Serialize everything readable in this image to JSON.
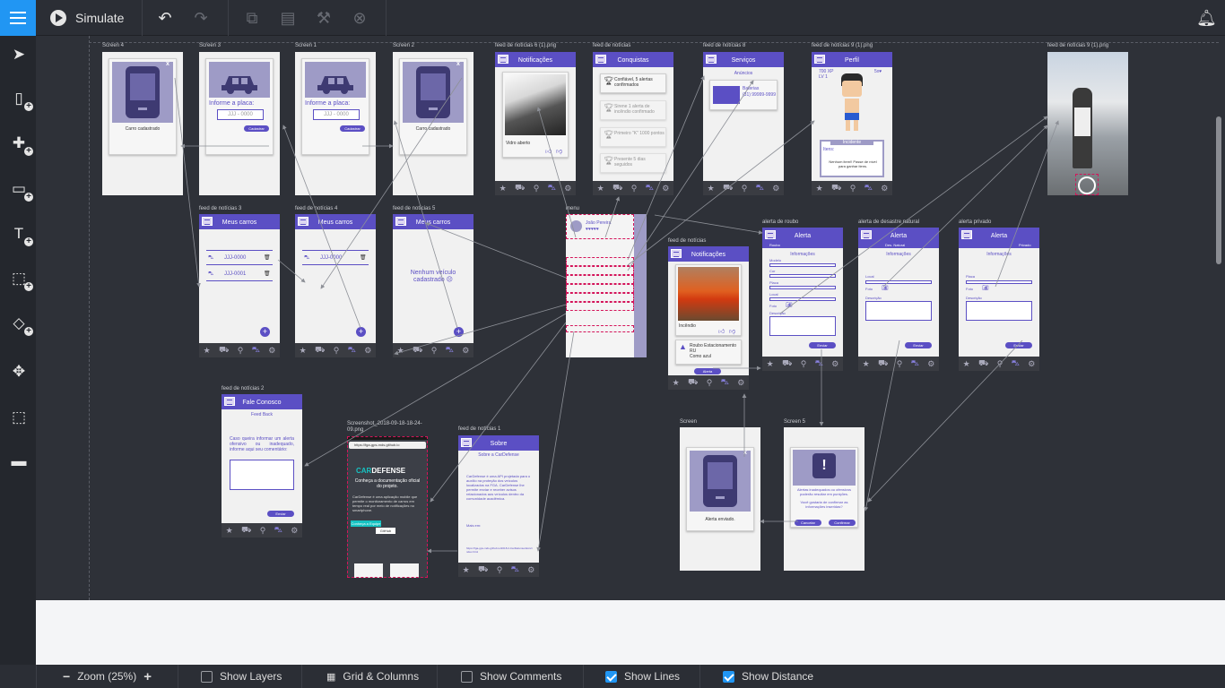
{
  "toolbar": {
    "simulate_label": "Simulate",
    "icons": [
      "menu-icon",
      "play-icon",
      "undo-icon",
      "redo-icon",
      "copy-icon",
      "paste-icon",
      "format-painter-icon",
      "delete-icon",
      "bell-icon"
    ]
  },
  "sidebar": {
    "tools": [
      "pointer-icon",
      "device-add-icon",
      "component-add-icon",
      "rectangle-add-icon",
      "text-add-icon",
      "selection-add-icon",
      "fill-icon",
      "move-icon",
      "area-select-icon",
      "comment-icon"
    ]
  },
  "statusbar": {
    "zoom_label": "Zoom (25%)",
    "show_layers": "Show Layers",
    "grid_columns": "Grid & Columns",
    "show_comments": "Show Comments",
    "show_lines": "Show Lines",
    "show_distance": "Show Distance",
    "show_layers_checked": false,
    "show_comments_checked": false,
    "show_lines_checked": true,
    "show_distance_checked": true
  },
  "accent": "#5b4fc4",
  "screens": {
    "screen4": {
      "label": "Screen 4",
      "caption": "Carro cadastrado"
    },
    "screen3": {
      "label": "Screen 3",
      "prompt": "Informe a placa:",
      "placeholder": "JJJ - 0000",
      "button": "Cadastrar"
    },
    "screen1": {
      "label": "Screen 1",
      "prompt": "Informe a placa:",
      "placeholder": "JJJ - 0000",
      "button": "Cadastrar"
    },
    "screen2": {
      "label": "Screen 2",
      "caption": "Carro cadastrado"
    },
    "feed6": {
      "label": "feed de notícias 6 (1).png",
      "title": "Notificações",
      "caption": "Vidro aberto"
    },
    "conquistas": {
      "label": "feed de notícias",
      "title": "Conquistas",
      "items": [
        "Confiável, 5 alertas confirmados",
        "Sirene 1 alerta de incêndio confirmado",
        "Primeiro \"K\" 1000 pontos",
        "Presente 5 dias seguidos"
      ]
    },
    "servicos": {
      "label": "feed de notícias 8",
      "title": "Serviços",
      "subtitle": "Anúncios",
      "ad_title": "Baterias",
      "ad_phone": "(31) 99999-9999"
    },
    "perfil": {
      "label": "feed de notícias 9 (1).png",
      "title": "Perfil",
      "xp": "700 XP",
      "level": "LV 1",
      "likes": "5x♥",
      "section": "Incidente",
      "items_label": "Itens:",
      "items_text": "Nenhum item!! Passe de nível para ganhar itens."
    },
    "photo9": {
      "label": "feed de notícias 9 (1).png"
    },
    "feed3": {
      "label": "feed de notícias 3",
      "title": "Meus carros",
      "plates": [
        "JJJ-0000",
        "JJJ-0001"
      ]
    },
    "feed4": {
      "label": "feed de notícias 4",
      "title": "Meus carros",
      "plates": [
        "JJJ-0000"
      ]
    },
    "feed5": {
      "label": "feed de notícias 5",
      "title": "Meus carros",
      "empty": "Nenhum veículo cadastrado ☹"
    },
    "menu": {
      "label": "menu",
      "user": "João Pereira",
      "hearts": "♥♥♥♥♥"
    },
    "notif": {
      "label": "feed de notícias",
      "title": "Notificações",
      "caption": "Incêndio",
      "alert_title": "Roubo Estacionamento RU",
      "alert_sub": "Como azul",
      "button": "Alerta"
    },
    "roubo": {
      "label": "alerta de roubo",
      "title": "Alerta",
      "tab": "Roubo",
      "section": "Informações",
      "fields": [
        "Modelo",
        "Cor",
        "Placa",
        "Local",
        "Foto",
        "Descrição"
      ],
      "button": "Enviar"
    },
    "desastre": {
      "label": "alerta de desastre natural",
      "title": "Alerta",
      "tab": "Des. Natural",
      "section": "Informações",
      "fields": [
        "Local",
        "Foto",
        "Descrição"
      ],
      "button": "Enviar"
    },
    "privado": {
      "label": "alerta privado",
      "title": "Alerta",
      "tab": "Privado",
      "section": "Informações",
      "fields": [
        "Placa",
        "Foto",
        "Descrição"
      ],
      "button": "Enviar"
    },
    "fale": {
      "label": "feed de notícias 2",
      "title": "Fale Conosco",
      "subtitle": "Feed Back",
      "body": "Caso queira informar um alerta ofensivo ou inadequado, informe aqui seu comentário:",
      "button": "Enviar"
    },
    "screenshot": {
      "label": "Screenshot_2018-09-18-18-24-09.png",
      "url": "https://fga-gps-mds.github.io",
      "brand_prefix": "CAR",
      "brand_suffix": "DEFENSE",
      "headline": "Conheça a documentação oficial do projeto.",
      "body": "CarDefense é uma aplicação mobile que permite o monitoramento de carros em tempo real por meio de notificações no smartphone.",
      "btn1": "Conheça a Equipe",
      "btn2": "GitHub"
    },
    "sobre": {
      "label": "feed de notícias 1",
      "title": "Sobre",
      "subtitle": "Sobre a CarDefense",
      "body": "CarDefense é uma API projetada para o auxílio na proteção dos veículos localizados na FGA. CarDefense lhe permite enviar e receber avisos relacionados aos veículos dentro da comunidade acadêmica.",
      "more": "Mais em:",
      "link": "https://fga-gps-mds.github.io/2018.2-CarDefense/docs/index.html"
    },
    "alerta_enviado": {
      "label": "Screen",
      "caption": "Alerta enviado."
    },
    "screen5": {
      "label": "Screen 5",
      "message": "Alertas inadequados ou ofensivos poderão resultar em punições.",
      "question": "Você gostaria de confirmar as informações inseridas?",
      "cancel": "Cancelar",
      "confirm": "Confirmar"
    }
  }
}
